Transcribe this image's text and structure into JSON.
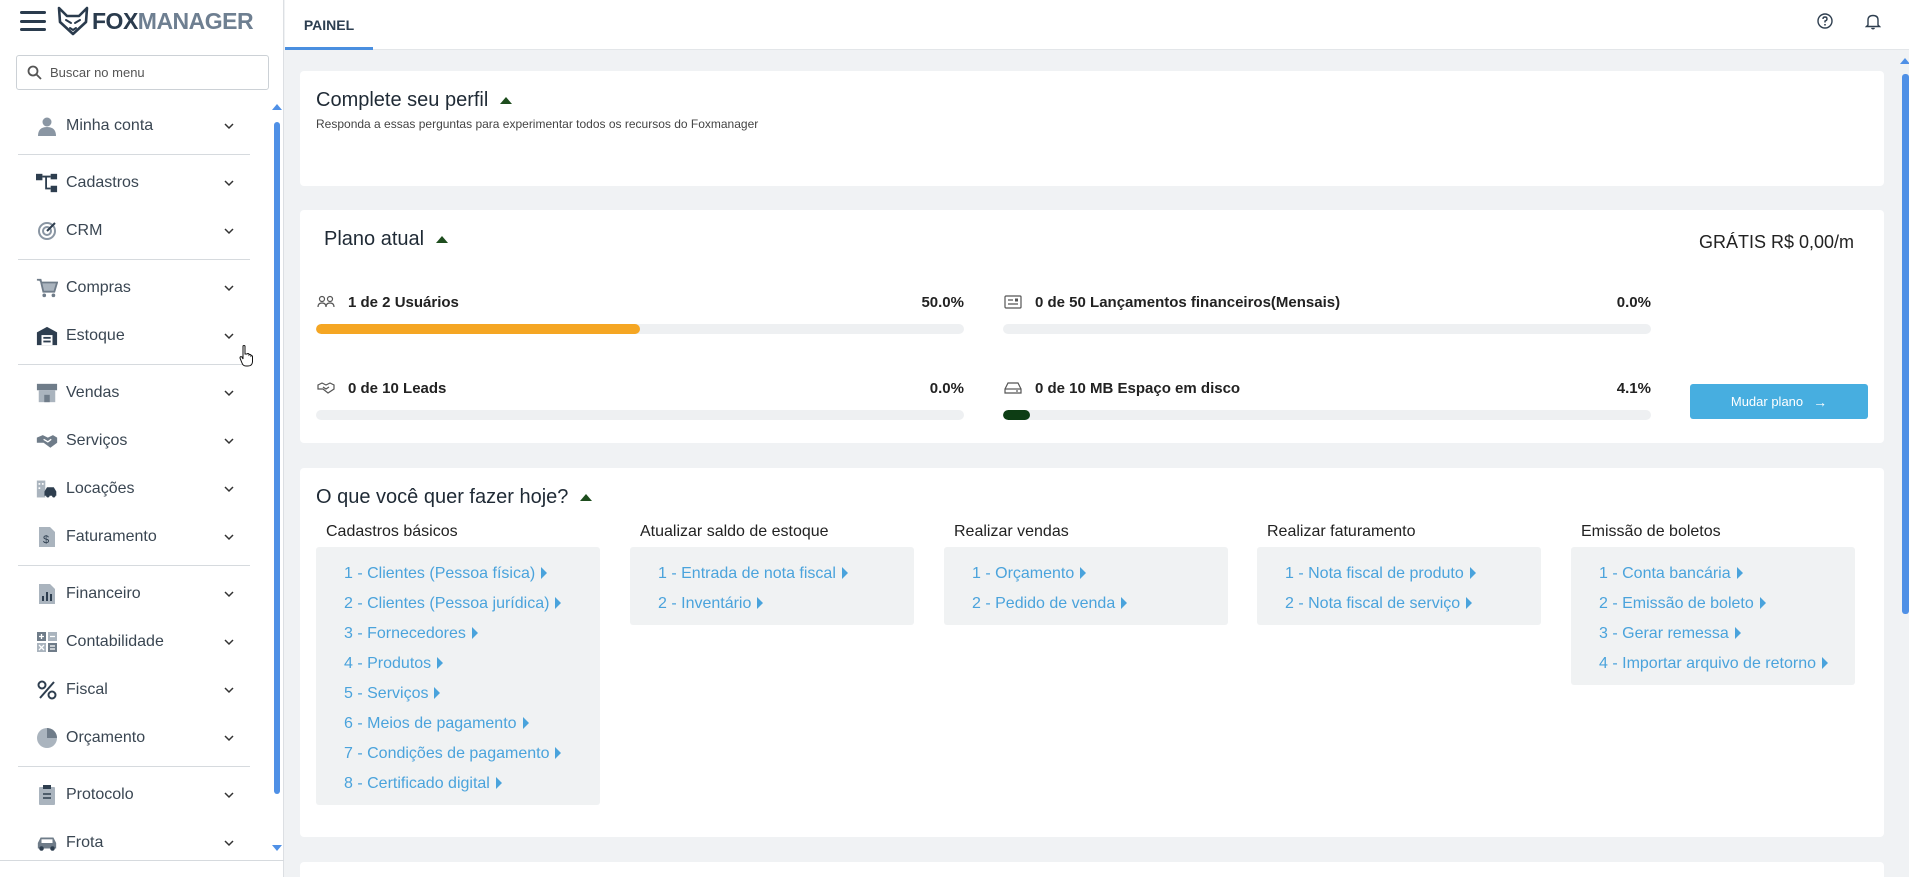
{
  "app": {
    "logo_fox": "FOX",
    "logo_manager": "MANAGER"
  },
  "sidebar": {
    "search_placeholder": "Buscar no menu",
    "items": [
      {
        "label": "Minha conta",
        "icon": "user-icon"
      },
      {
        "label": "Cadastros",
        "icon": "hierarchy-icon"
      },
      {
        "label": "CRM",
        "icon": "target-icon"
      },
      {
        "label": "Compras",
        "icon": "cart-icon"
      },
      {
        "label": "Estoque",
        "icon": "warehouse-icon"
      },
      {
        "label": "Vendas",
        "icon": "store-icon"
      },
      {
        "label": "Serviços",
        "icon": "handshake-icon"
      },
      {
        "label": "Locações",
        "icon": "building-car-icon"
      },
      {
        "label": "Faturamento",
        "icon": "invoice-icon"
      },
      {
        "label": "Financeiro",
        "icon": "finance-chart-icon"
      },
      {
        "label": "Contabilidade",
        "icon": "calculator-icon"
      },
      {
        "label": "Fiscal",
        "icon": "percent-icon"
      },
      {
        "label": "Orçamento",
        "icon": "pie-chart-icon"
      },
      {
        "label": "Protocolo",
        "icon": "clipboard-icon"
      },
      {
        "label": "Frota",
        "icon": "car-icon"
      }
    ]
  },
  "topbar": {
    "tab_label": "PAINEL",
    "help_icon": "help-circle-icon",
    "bell_icon": "bell-icon"
  },
  "profile": {
    "title": "Complete seu perfil",
    "subtitle": "Responda a essas perguntas para experimentar todos os recursos do Foxmanager"
  },
  "plan": {
    "title": "Plano atual",
    "price": "GRÁTIS R$ 0,00/m",
    "usages": [
      {
        "label": "1 de 2 Usuários",
        "pct_text": "50.0%",
        "fill": 0.5,
        "color": "#f5a623",
        "icon": "users-icon"
      },
      {
        "label": "0 de 50 Lançamentos financeiros(Mensais)",
        "pct_text": "0.0%",
        "fill": 0.0,
        "color": "#f5a623",
        "icon": "receipt-icon"
      },
      {
        "label": "0 de 10 Leads",
        "pct_text": "0.0%",
        "fill": 0.0,
        "color": "#f5a623",
        "icon": "handshake-icon"
      },
      {
        "label": "0 de 10 MB Espaço em disco",
        "pct_text": "4.1%",
        "fill": 0.041,
        "color": "#0d3d14",
        "icon": "hard-drive-icon"
      }
    ],
    "change_button": "Mudar plano"
  },
  "todo": {
    "title": "O que você quer fazer hoje?",
    "columns": [
      {
        "heading": "Cadastros básicos",
        "links": [
          "1 - Clientes (Pessoa física)",
          "2 - Clientes (Pessoa jurídica)",
          "3 - Fornecedores",
          "4 - Produtos",
          "5 - Serviços",
          "6 - Meios de pagamento",
          "7 - Condições de pagamento",
          "8 - Certificado digital"
        ]
      },
      {
        "heading": "Atualizar saldo de estoque",
        "links": [
          "1 - Entrada de nota fiscal",
          "2 - Inventário"
        ]
      },
      {
        "heading": "Realizar vendas",
        "links": [
          "1 - Orçamento",
          "2 - Pedido de venda"
        ]
      },
      {
        "heading": "Realizar faturamento",
        "links": [
          "1 - Nota fiscal de produto",
          "2 - Nota fiscal de serviço"
        ]
      },
      {
        "heading": "Emissão de boletos",
        "links": [
          "1 - Conta bancária",
          "2 - Emissão de boleto",
          "3 - Gerar remessa",
          "4 - Importar arquivo de retorno"
        ]
      }
    ]
  }
}
